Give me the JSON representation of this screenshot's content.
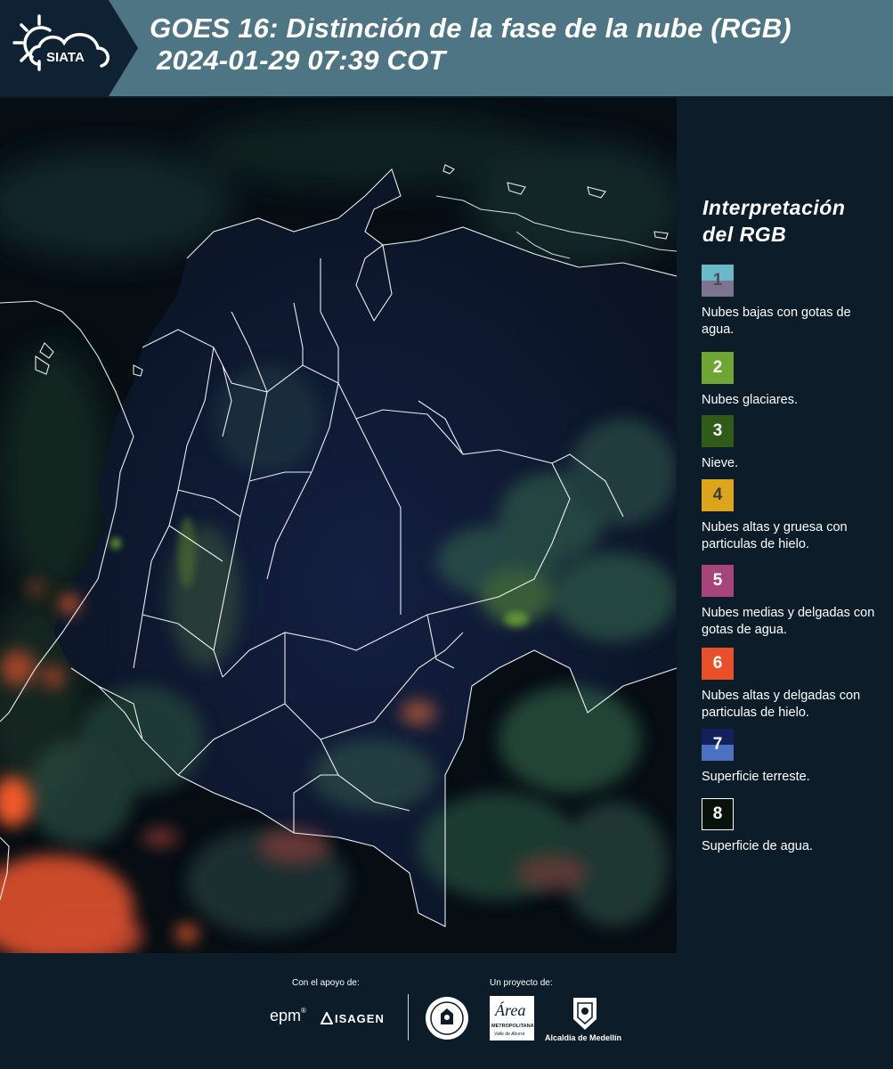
{
  "header": {
    "logo_text": "SIATA",
    "title_line1": "GOES 16: Distinción de la fase de la nube (RGB)",
    "title_line2": "2024-01-29 07:39 COT"
  },
  "legend": {
    "title_line1": "Interpretación",
    "title_line2": "del RGB",
    "items": [
      {
        "number": "1",
        "label": "Nubes bajas con gotas de agua.",
        "color_top": "#6ab9c9",
        "color_bottom": "#7d7590",
        "number_color": "#4a4a5a"
      },
      {
        "number": "2",
        "label": "Nubes glaciares.",
        "color_top": "#6ea533",
        "color_bottom": "#6ea533",
        "number_color": "#ffffff"
      },
      {
        "number": "3",
        "label": "Nieve.",
        "color_top": "#2f5c18",
        "color_bottom": "#2f5c18",
        "number_color": "#ffffff"
      },
      {
        "number": "4",
        "label": "Nubes altas y gruesa con particulas de hielo.",
        "color_top": "#dca51b",
        "color_bottom": "#dca51b",
        "number_color": "#3a3a3a"
      },
      {
        "number": "5",
        "label": "Nubes medias y delgadas con gotas de agua.",
        "color_top": "#a5457a",
        "color_bottom": "#a5457a",
        "number_color": "#ffffff"
      },
      {
        "number": "6",
        "label": "Nubes altas y delgadas con particulas de hielo.",
        "color_top": "#e8502a",
        "color_bottom": "#e8502a",
        "number_color": "#ffffff"
      },
      {
        "number": "7",
        "label": "Superficie terreste.",
        "color_top": "#13205c",
        "color_bottom": "#4a72c0",
        "number_color": "#ffffff"
      },
      {
        "number": "8",
        "label": "Superficie de agua.",
        "color_top": "#07120a",
        "color_bottom": "#07120a",
        "number_color": "#ffffff"
      }
    ]
  },
  "footer": {
    "support_label": "Con el apoyo de:",
    "project_label": "Un proyecto de:",
    "sponsor_epm": "epm",
    "sponsor_epm_mark": "®",
    "sponsor_isagen": "ISAGEN",
    "partner_metropolitana": "Área",
    "partner_metropolitana_sub": "METROPOLITANA",
    "partner_metropolitana_sub2": "Valle de Aburrá",
    "partner_medellin": "Alcaldía de Medellín"
  },
  "map": {
    "background_color": "#060e14",
    "border_color": "#ffffff",
    "cloud_colors": {
      "ice_thin": "#e8502a",
      "glacial": "#6ea533",
      "low_water": "#6ab9c9",
      "land": "#13205c"
    }
  }
}
